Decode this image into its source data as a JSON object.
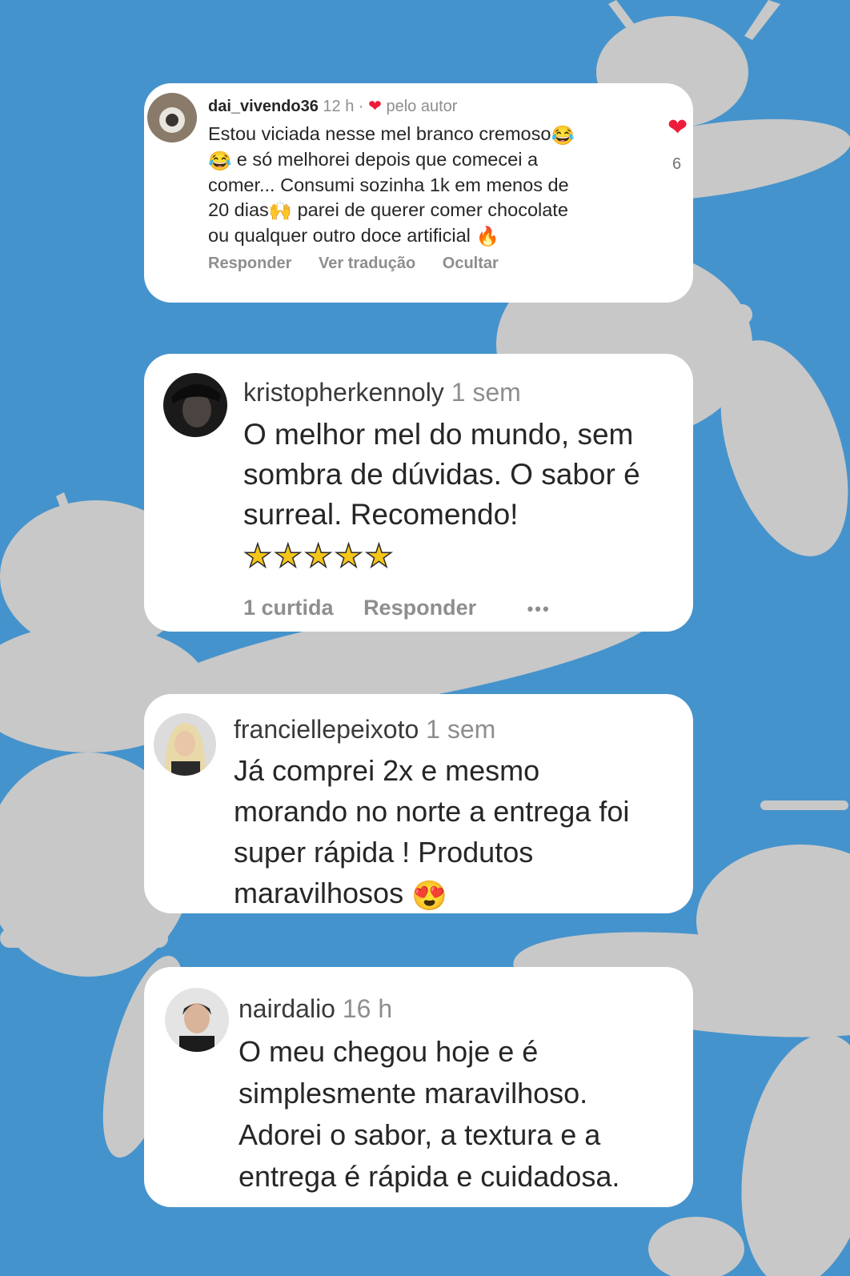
{
  "comments": [
    {
      "username": "dai_vivendo36",
      "time": "12 h",
      "author_badge": "pelo autor",
      "lines": [
        "Estou viciada nesse mel branco cremoso",
        "e só melhorei depois que comecei a",
        "comer... Consumi sozinha 1k em menos de",
        "20 dias",
        "parei de querer comer chocolate",
        "ou qualquer outro doce artificial"
      ],
      "likes": "6",
      "actions": [
        "Responder",
        "Ver tradução",
        "Ocultar"
      ],
      "icons": [
        "heart-icon",
        "joy-emoji-icon",
        "raised-hands-emoji-icon",
        "fire-emoji-icon"
      ]
    },
    {
      "username": "kristopherkennoly",
      "time": "1 sem",
      "lines": [
        "O melhor mel do mundo, sem",
        "sombra de dúvidas. O sabor é",
        "surreal. Recomendo!"
      ],
      "stars": 5,
      "actions": [
        "1 curtida",
        "Responder"
      ],
      "more": "•••"
    },
    {
      "username": "franciellepeixoto",
      "time": "1 sem",
      "lines": [
        "Já comprei 2x e mesmo",
        "morando no norte a entrega foi",
        "super rápida ! Produtos",
        "maravilhosos"
      ],
      "icons": [
        "heart-eyes-emoji-icon"
      ]
    },
    {
      "username": "nairdalio",
      "time": "16 h",
      "lines": [
        "O meu chegou hoje e é",
        "simplesmente maravilhoso.",
        "Adorei o sabor, a textura e a",
        "entrega é rápida e cuidadosa."
      ]
    }
  ],
  "colors": {
    "background": "#4593cc",
    "bee_art": "#c8c8c8",
    "card": "#ffffff",
    "text": "#262626",
    "muted": "#8e8e8e",
    "heart": "#ed1c3a"
  }
}
